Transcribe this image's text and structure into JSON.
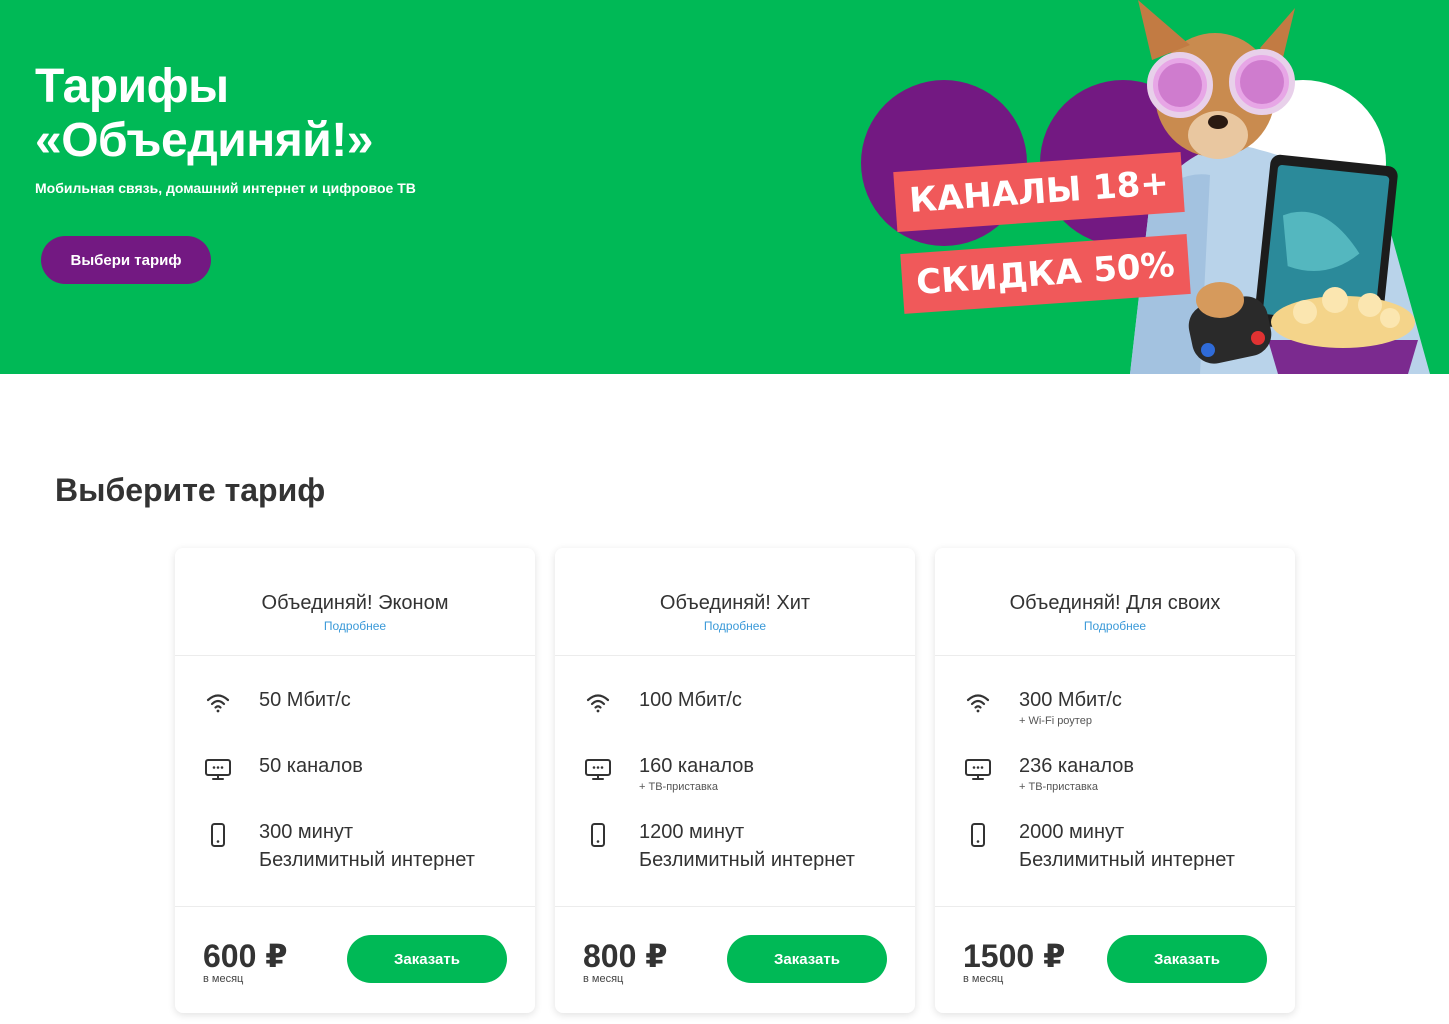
{
  "hero": {
    "title_line1": "Тарифы",
    "title_line2": "«Объединяй!»",
    "subtitle": "Мобильная связь, домашний интернет и цифровое ТВ",
    "cta_label": "Выбери тариф",
    "promo_tag1": "КАНАЛЫ 18+",
    "promo_tag2": "СКИДКА 50%",
    "colors": {
      "background": "#00b956",
      "accent": "#731982",
      "promo": "#f0595a"
    }
  },
  "section": {
    "title": "Выберите тариф"
  },
  "cards": [
    {
      "name": "Объединяй! Эконом",
      "more": "Подробнее",
      "internet": "50 Мбит/с",
      "internet_note": "",
      "tv": "50 каналов",
      "tv_note": "",
      "minutes": "300 минут",
      "mobile_internet": "Безлимитный интернет",
      "price": "600 ₽",
      "period": "в месяц",
      "order": "Заказать"
    },
    {
      "name": "Объединяй! Хит",
      "more": "Подробнее",
      "internet": "100 Мбит/с",
      "internet_note": "",
      "tv": "160 каналов",
      "tv_note": "+ ТВ-приставка",
      "minutes": "1200 минут",
      "mobile_internet": "Безлимитный интернет",
      "price": "800 ₽",
      "period": "в месяц",
      "order": "Заказать"
    },
    {
      "name": "Объединяй! Для своих",
      "more": "Подробнее",
      "internet": "300 Мбит/с",
      "internet_note": "+ Wi-Fi роутер",
      "tv": "236 каналов",
      "tv_note": "+ ТВ-приставка",
      "minutes": "2000 минут",
      "mobile_internet": "Безлимитный интернет",
      "price": "1500 ₽",
      "period": "в месяц",
      "order": "Заказать"
    }
  ],
  "icons": [
    "wifi-icon",
    "tv-icon",
    "phone-icon"
  ]
}
